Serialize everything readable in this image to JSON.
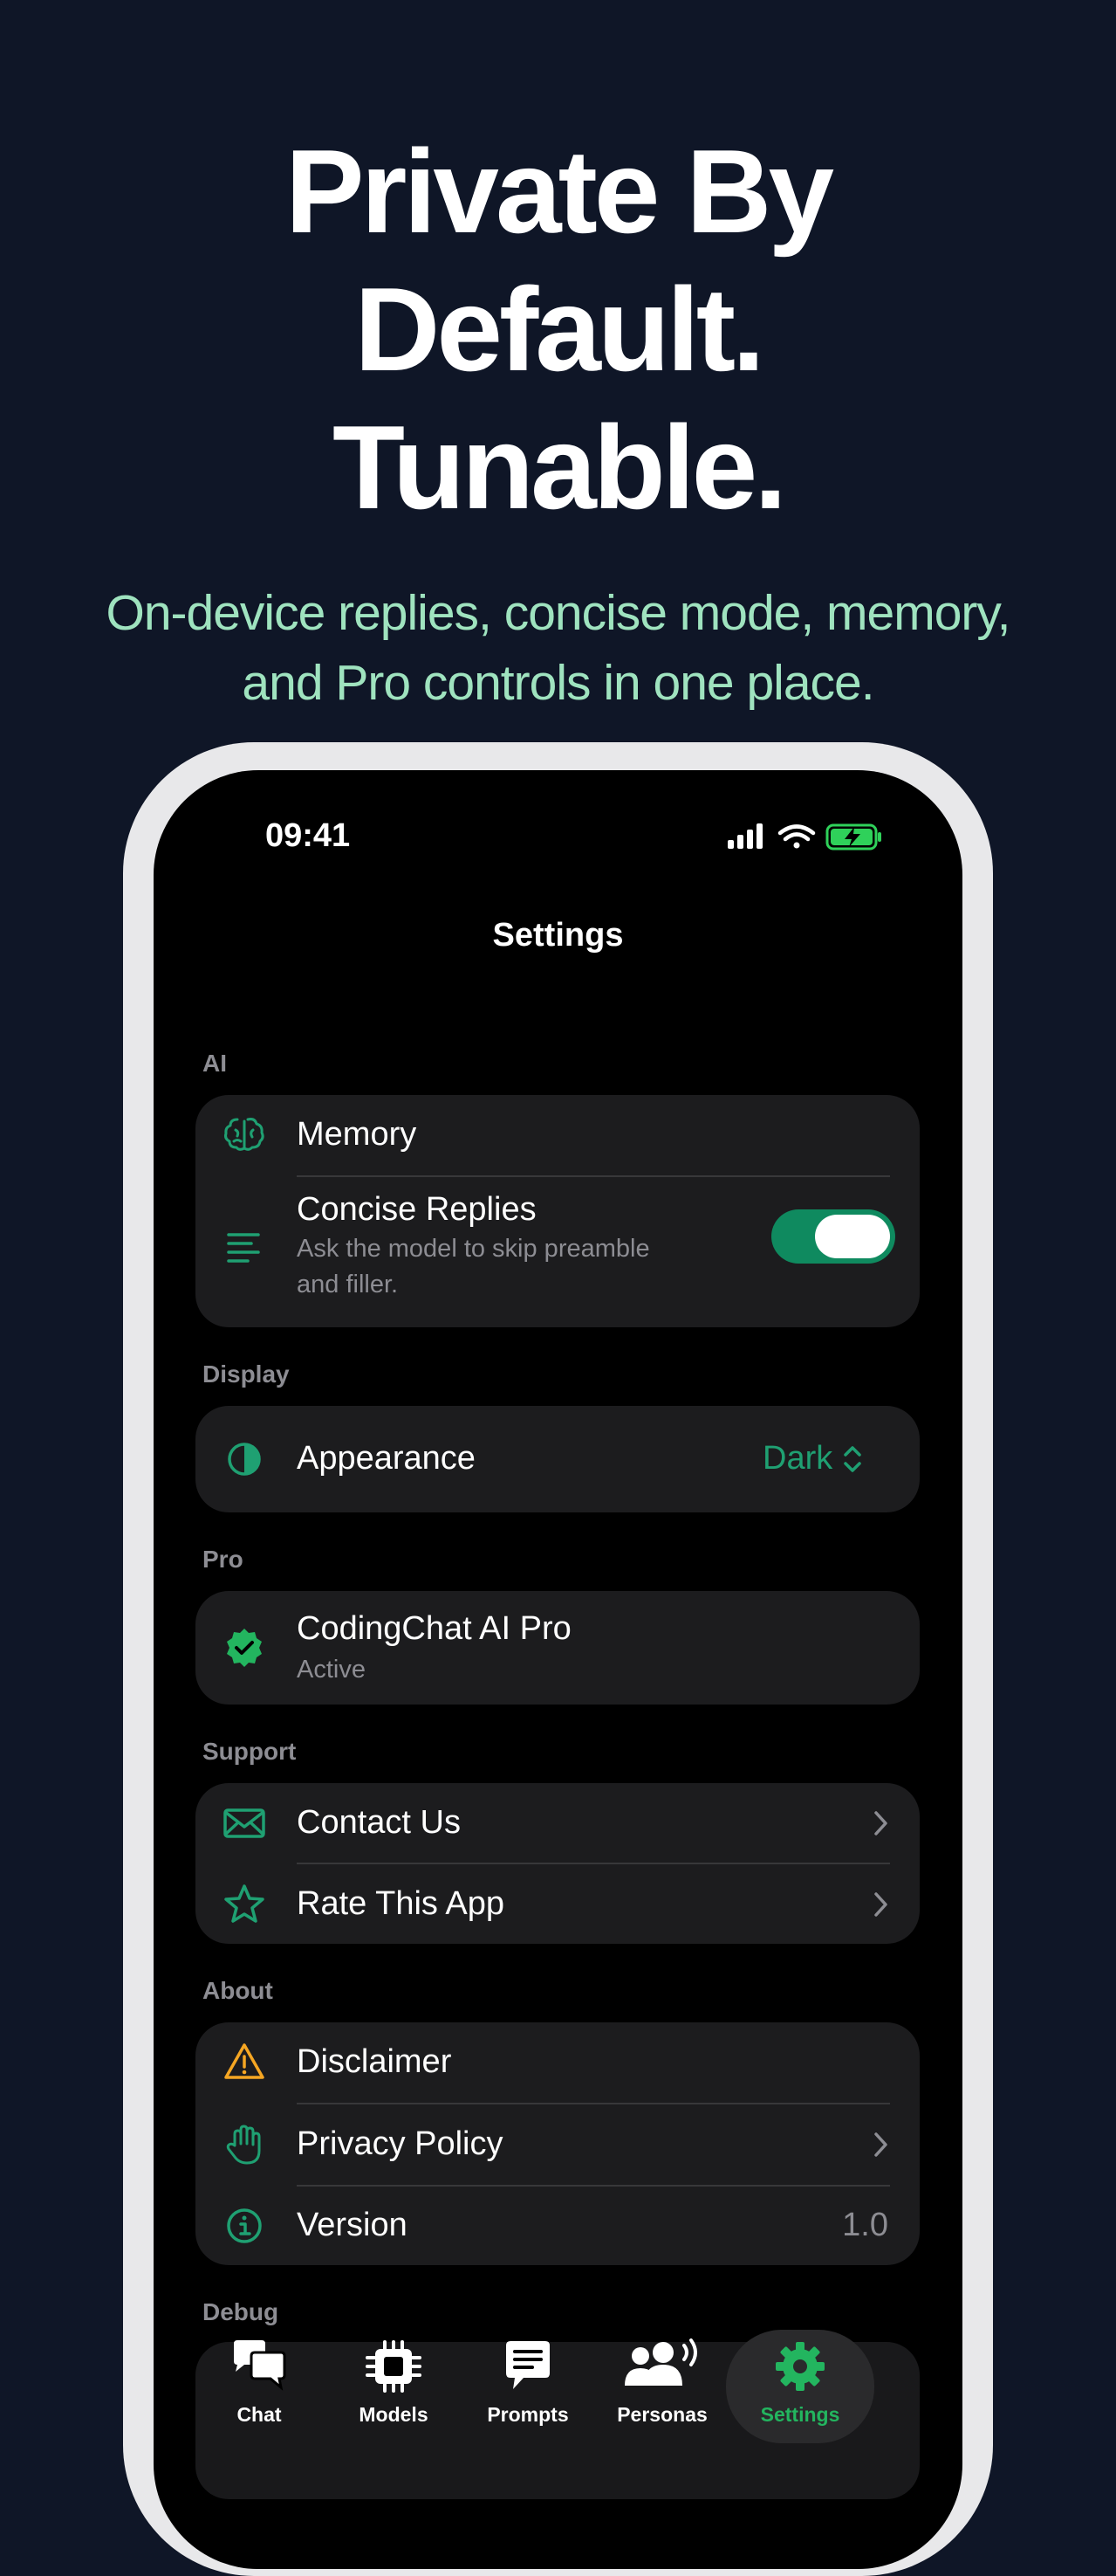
{
  "hero": {
    "title_line1": "Private By",
    "title_line2": "Default.",
    "title_line3": "Tunable.",
    "subtitle_line1": "On-device replies, concise mode, memory,",
    "subtitle_line2": "and Pro controls in one place."
  },
  "status_bar": {
    "time": "09:41"
  },
  "nav": {
    "title": "Settings"
  },
  "sections": {
    "ai": {
      "label": "AI",
      "memory": {
        "label": "Memory",
        "icon": "brain-icon"
      },
      "concise": {
        "label": "Concise Replies",
        "desc_line1": "Ask the model to skip preamble",
        "desc_line2": "and filler.",
        "icon": "lines-icon",
        "enabled": true
      }
    },
    "display": {
      "label": "Display",
      "appearance": {
        "label": "Appearance",
        "value": "Dark",
        "icon": "contrast-icon"
      }
    },
    "pro": {
      "label": "Pro",
      "plan": {
        "label": "CodingChat AI Pro",
        "status": "Active",
        "icon": "verified-badge-icon"
      }
    },
    "support": {
      "label": "Support",
      "contact": {
        "label": "Contact Us",
        "icon": "envelope-icon"
      },
      "rate": {
        "label": "Rate This App",
        "icon": "star-icon"
      }
    },
    "about": {
      "label": "About",
      "disclaimer": {
        "label": "Disclaimer",
        "icon": "warning-icon"
      },
      "privacy": {
        "label": "Privacy Policy",
        "icon": "hand-icon"
      },
      "version": {
        "label": "Version",
        "value": "1.0",
        "icon": "info-icon"
      }
    },
    "debug": {
      "label": "Debug"
    }
  },
  "tabbar": {
    "tabs": [
      {
        "label": "Chat",
        "icon": "chat-bubbles-icon"
      },
      {
        "label": "Models",
        "icon": "chip-icon"
      },
      {
        "label": "Prompts",
        "icon": "prompt-bubble-icon"
      },
      {
        "label": "Personas",
        "icon": "people-speaking-icon"
      },
      {
        "label": "Settings",
        "icon": "gear-icon",
        "active": true
      }
    ]
  },
  "colors": {
    "background": "#0f1627",
    "accent": "#23b55f",
    "icon_green": "#1fa072",
    "warning": "#f5a623",
    "subtitle": "#9fe3bf"
  }
}
